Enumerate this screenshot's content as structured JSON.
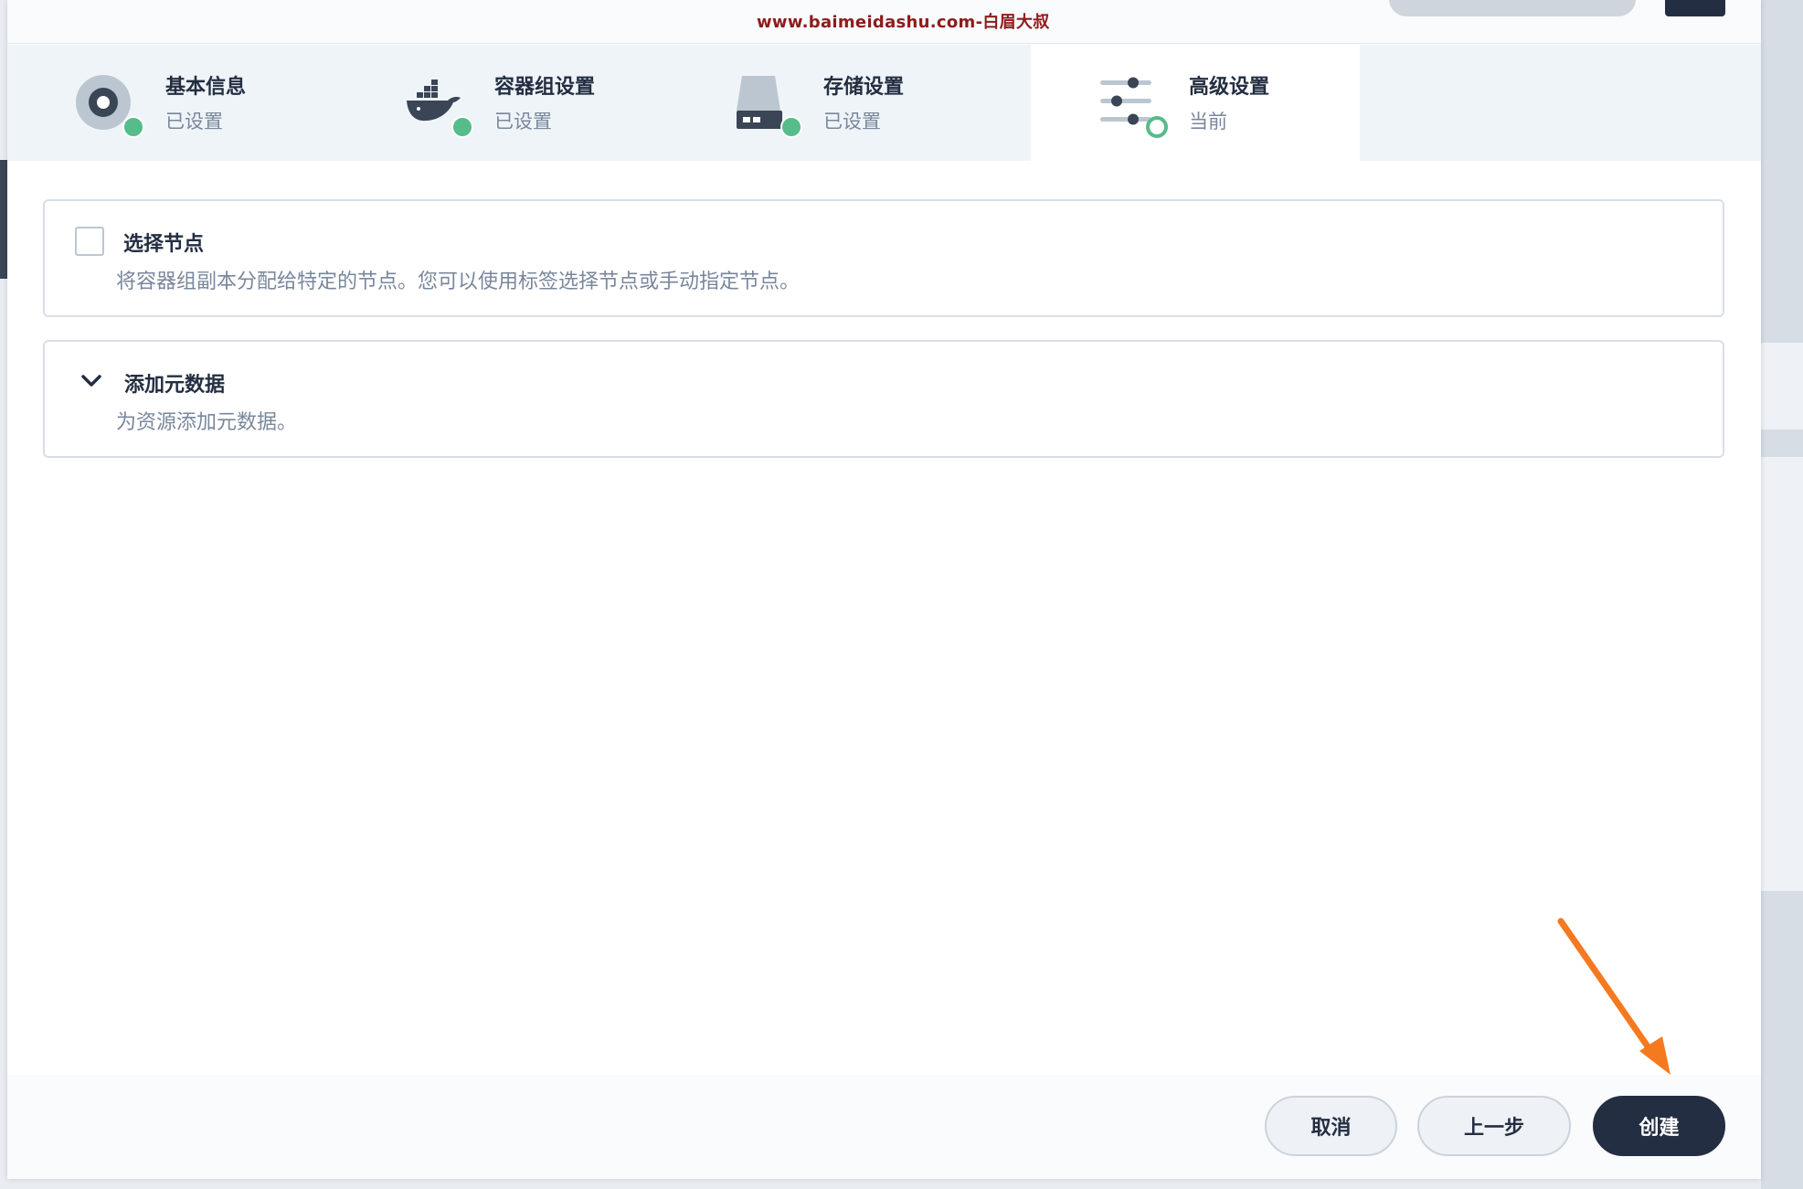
{
  "watermark": "www.baimeidashu.com-白眉大叔",
  "steps": [
    {
      "title": "基本信息",
      "status": "已设置",
      "icon": "disc-icon"
    },
    {
      "title": "容器组设置",
      "status": "已设置",
      "icon": "docker-whale-icon"
    },
    {
      "title": "存储设置",
      "status": "已设置",
      "icon": "hard-drive-icon"
    },
    {
      "title": "高级设置",
      "status": "当前",
      "icon": "sliders-icon"
    }
  ],
  "sections": {
    "node_selection": {
      "title": "选择节点",
      "description": "将容器组副本分配给特定的节点。您可以使用标签选择节点或手动指定节点。",
      "checked": false
    },
    "metadata": {
      "title": "添加元数据",
      "description": "为资源添加元数据。"
    }
  },
  "footer": {
    "cancel_label": "取消",
    "previous_label": "上一步",
    "create_label": "创建"
  },
  "colors": {
    "primary_dark": "#242e42",
    "success_green": "#55bc8a",
    "annotation_arrow": "#f5791f",
    "watermark": "#8e1b1b"
  }
}
